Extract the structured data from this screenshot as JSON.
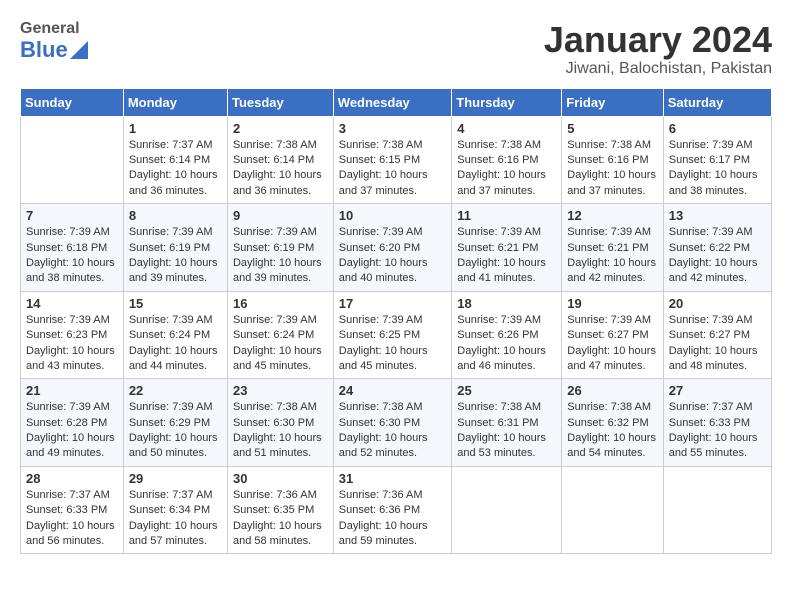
{
  "logo": {
    "general": "General",
    "blue": "Blue"
  },
  "title": "January 2024",
  "subtitle": "Jiwani, Balochistan, Pakistan",
  "headers": [
    "Sunday",
    "Monday",
    "Tuesday",
    "Wednesday",
    "Thursday",
    "Friday",
    "Saturday"
  ],
  "weeks": [
    [
      {
        "day": "",
        "sunrise": "",
        "sunset": "",
        "daylight": ""
      },
      {
        "day": "1",
        "sunrise": "Sunrise: 7:37 AM",
        "sunset": "Sunset: 6:14 PM",
        "daylight": "Daylight: 10 hours and 36 minutes."
      },
      {
        "day": "2",
        "sunrise": "Sunrise: 7:38 AM",
        "sunset": "Sunset: 6:14 PM",
        "daylight": "Daylight: 10 hours and 36 minutes."
      },
      {
        "day": "3",
        "sunrise": "Sunrise: 7:38 AM",
        "sunset": "Sunset: 6:15 PM",
        "daylight": "Daylight: 10 hours and 37 minutes."
      },
      {
        "day": "4",
        "sunrise": "Sunrise: 7:38 AM",
        "sunset": "Sunset: 6:16 PM",
        "daylight": "Daylight: 10 hours and 37 minutes."
      },
      {
        "day": "5",
        "sunrise": "Sunrise: 7:38 AM",
        "sunset": "Sunset: 6:16 PM",
        "daylight": "Daylight: 10 hours and 37 minutes."
      },
      {
        "day": "6",
        "sunrise": "Sunrise: 7:39 AM",
        "sunset": "Sunset: 6:17 PM",
        "daylight": "Daylight: 10 hours and 38 minutes."
      }
    ],
    [
      {
        "day": "7",
        "sunrise": "Sunrise: 7:39 AM",
        "sunset": "Sunset: 6:18 PM",
        "daylight": "Daylight: 10 hours and 38 minutes."
      },
      {
        "day": "8",
        "sunrise": "Sunrise: 7:39 AM",
        "sunset": "Sunset: 6:19 PM",
        "daylight": "Daylight: 10 hours and 39 minutes."
      },
      {
        "day": "9",
        "sunrise": "Sunrise: 7:39 AM",
        "sunset": "Sunset: 6:19 PM",
        "daylight": "Daylight: 10 hours and 39 minutes."
      },
      {
        "day": "10",
        "sunrise": "Sunrise: 7:39 AM",
        "sunset": "Sunset: 6:20 PM",
        "daylight": "Daylight: 10 hours and 40 minutes."
      },
      {
        "day": "11",
        "sunrise": "Sunrise: 7:39 AM",
        "sunset": "Sunset: 6:21 PM",
        "daylight": "Daylight: 10 hours and 41 minutes."
      },
      {
        "day": "12",
        "sunrise": "Sunrise: 7:39 AM",
        "sunset": "Sunset: 6:21 PM",
        "daylight": "Daylight: 10 hours and 42 minutes."
      },
      {
        "day": "13",
        "sunrise": "Sunrise: 7:39 AM",
        "sunset": "Sunset: 6:22 PM",
        "daylight": "Daylight: 10 hours and 42 minutes."
      }
    ],
    [
      {
        "day": "14",
        "sunrise": "Sunrise: 7:39 AM",
        "sunset": "Sunset: 6:23 PM",
        "daylight": "Daylight: 10 hours and 43 minutes."
      },
      {
        "day": "15",
        "sunrise": "Sunrise: 7:39 AM",
        "sunset": "Sunset: 6:24 PM",
        "daylight": "Daylight: 10 hours and 44 minutes."
      },
      {
        "day": "16",
        "sunrise": "Sunrise: 7:39 AM",
        "sunset": "Sunset: 6:24 PM",
        "daylight": "Daylight: 10 hours and 45 minutes."
      },
      {
        "day": "17",
        "sunrise": "Sunrise: 7:39 AM",
        "sunset": "Sunset: 6:25 PM",
        "daylight": "Daylight: 10 hours and 45 minutes."
      },
      {
        "day": "18",
        "sunrise": "Sunrise: 7:39 AM",
        "sunset": "Sunset: 6:26 PM",
        "daylight": "Daylight: 10 hours and 46 minutes."
      },
      {
        "day": "19",
        "sunrise": "Sunrise: 7:39 AM",
        "sunset": "Sunset: 6:27 PM",
        "daylight": "Daylight: 10 hours and 47 minutes."
      },
      {
        "day": "20",
        "sunrise": "Sunrise: 7:39 AM",
        "sunset": "Sunset: 6:27 PM",
        "daylight": "Daylight: 10 hours and 48 minutes."
      }
    ],
    [
      {
        "day": "21",
        "sunrise": "Sunrise: 7:39 AM",
        "sunset": "Sunset: 6:28 PM",
        "daylight": "Daylight: 10 hours and 49 minutes."
      },
      {
        "day": "22",
        "sunrise": "Sunrise: 7:39 AM",
        "sunset": "Sunset: 6:29 PM",
        "daylight": "Daylight: 10 hours and 50 minutes."
      },
      {
        "day": "23",
        "sunrise": "Sunrise: 7:38 AM",
        "sunset": "Sunset: 6:30 PM",
        "daylight": "Daylight: 10 hours and 51 minutes."
      },
      {
        "day": "24",
        "sunrise": "Sunrise: 7:38 AM",
        "sunset": "Sunset: 6:30 PM",
        "daylight": "Daylight: 10 hours and 52 minutes."
      },
      {
        "day": "25",
        "sunrise": "Sunrise: 7:38 AM",
        "sunset": "Sunset: 6:31 PM",
        "daylight": "Daylight: 10 hours and 53 minutes."
      },
      {
        "day": "26",
        "sunrise": "Sunrise: 7:38 AM",
        "sunset": "Sunset: 6:32 PM",
        "daylight": "Daylight: 10 hours and 54 minutes."
      },
      {
        "day": "27",
        "sunrise": "Sunrise: 7:37 AM",
        "sunset": "Sunset: 6:33 PM",
        "daylight": "Daylight: 10 hours and 55 minutes."
      }
    ],
    [
      {
        "day": "28",
        "sunrise": "Sunrise: 7:37 AM",
        "sunset": "Sunset: 6:33 PM",
        "daylight": "Daylight: 10 hours and 56 minutes."
      },
      {
        "day": "29",
        "sunrise": "Sunrise: 7:37 AM",
        "sunset": "Sunset: 6:34 PM",
        "daylight": "Daylight: 10 hours and 57 minutes."
      },
      {
        "day": "30",
        "sunrise": "Sunrise: 7:36 AM",
        "sunset": "Sunset: 6:35 PM",
        "daylight": "Daylight: 10 hours and 58 minutes."
      },
      {
        "day": "31",
        "sunrise": "Sunrise: 7:36 AM",
        "sunset": "Sunset: 6:36 PM",
        "daylight": "Daylight: 10 hours and 59 minutes."
      },
      {
        "day": "",
        "sunrise": "",
        "sunset": "",
        "daylight": ""
      },
      {
        "day": "",
        "sunrise": "",
        "sunset": "",
        "daylight": ""
      },
      {
        "day": "",
        "sunrise": "",
        "sunset": "",
        "daylight": ""
      }
    ]
  ]
}
